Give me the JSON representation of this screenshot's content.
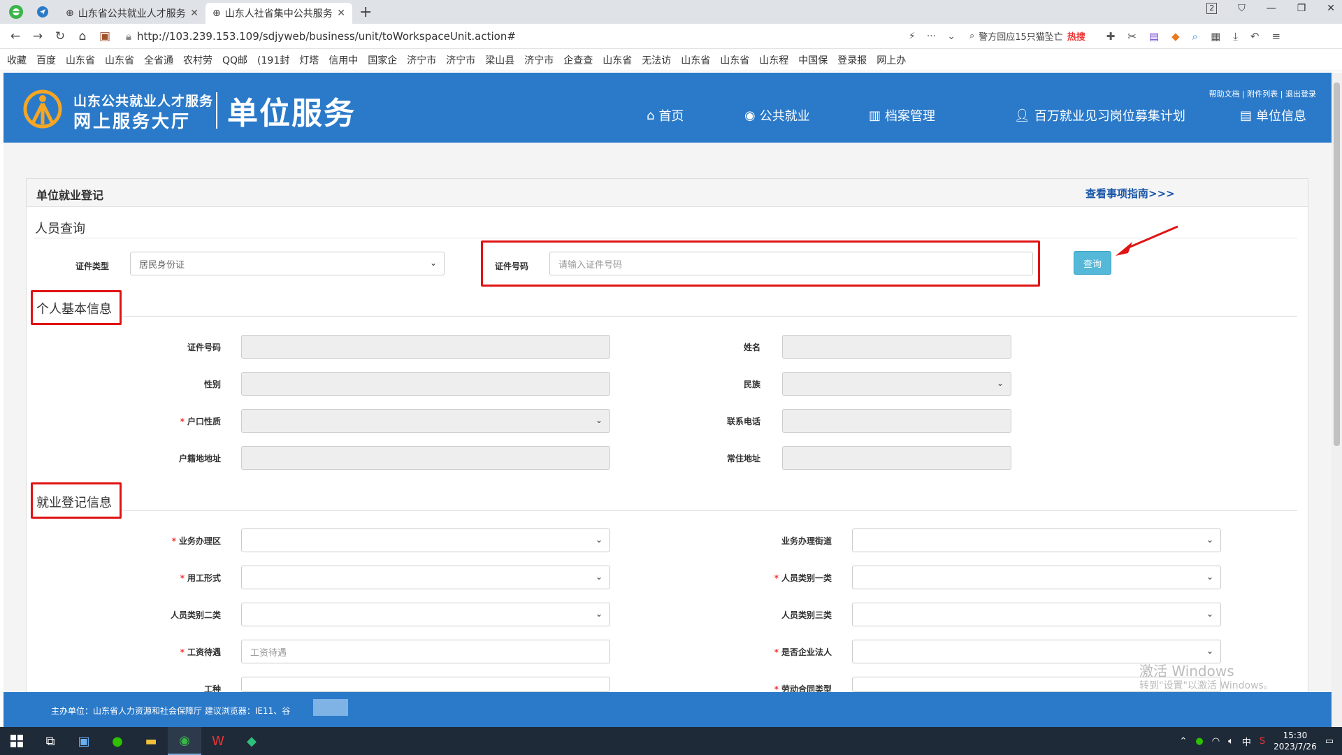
{
  "browser": {
    "tabs": [
      {
        "title": "山东省公共就业人才服务",
        "active": false
      },
      {
        "title": "山东人社省集中公共服务",
        "active": true
      }
    ],
    "url": "http://103.239.153.109/sdjyweb/business/unit/toWorkspaceUnit.action#",
    "search_text": "警方回应15只猫坠亡",
    "search_hot": "热搜",
    "tab_count": "2",
    "bookmarks": [
      "收藏",
      "百度",
      "山东省",
      "山东省",
      "全省通",
      "农村劳",
      "QQ邮",
      "(191封",
      "灯塔",
      "信用中",
      "国家企",
      "济宁市",
      "济宁市",
      "梁山县",
      "济宁市",
      "企查查",
      "山东省",
      "无法访",
      "山东省",
      "山东省",
      "山东程",
      "中国保",
      "登录报",
      "网上办"
    ]
  },
  "header": {
    "org_line1": "山东公共就业人才服务",
    "org_line2": "网上服务大厅",
    "section": "单位服务",
    "top_links": "帮助文档 | 附件列表 | 退出登录",
    "nav": [
      {
        "label": "首页",
        "icon": "home-icon"
      },
      {
        "label": "公共就业",
        "icon": "handshake-icon"
      },
      {
        "label": "档案管理",
        "icon": "archive-icon"
      },
      {
        "label": "百万就业见习岗位募集计划",
        "icon": "person-icon"
      },
      {
        "label": "单位信息",
        "icon": "building-icon"
      }
    ]
  },
  "panel": {
    "title": "单位就业登记",
    "guide_link": "查看事项指南>>>"
  },
  "query": {
    "section_title": "人员查询",
    "id_type_label": "证件类型",
    "id_type_value": "居民身份证",
    "id_no_label": "证件号码",
    "id_no_placeholder": "请输入证件号码",
    "button": "查询"
  },
  "basic": {
    "section_title": "个人基本信息",
    "fields": {
      "id_no": "证件号码",
      "name": "姓名",
      "gender": "性别",
      "ethnicity": "民族",
      "hukou_type": "户口性质",
      "phone": "联系电话",
      "hukou_addr": "户籍地地址",
      "residence_addr": "常住地址"
    }
  },
  "employment": {
    "section_title": "就业登记信息",
    "fields": {
      "district": "业务办理区",
      "street": "业务办理街道",
      "form": "用工形式",
      "category1": "人员类别一类",
      "category2": "人员类别二类",
      "category3": "人员类别三类",
      "salary": "工资待遇",
      "salary_placeholder": "工资待遇",
      "is_legal_rep": "是否企业法人",
      "job_type": "工种",
      "contract_type": "劳动合同类型"
    }
  },
  "footer": {
    "text": "主办单位：山东省人力资源和社会保障厅   建议浏览器：IE11、谷"
  },
  "watermark": {
    "line1": "激活 Windows",
    "line2": "转到\"设置\"以激活 Windows。"
  },
  "taskbar": {
    "time": "15:30",
    "date": "2023/7/26",
    "ime": "中"
  }
}
